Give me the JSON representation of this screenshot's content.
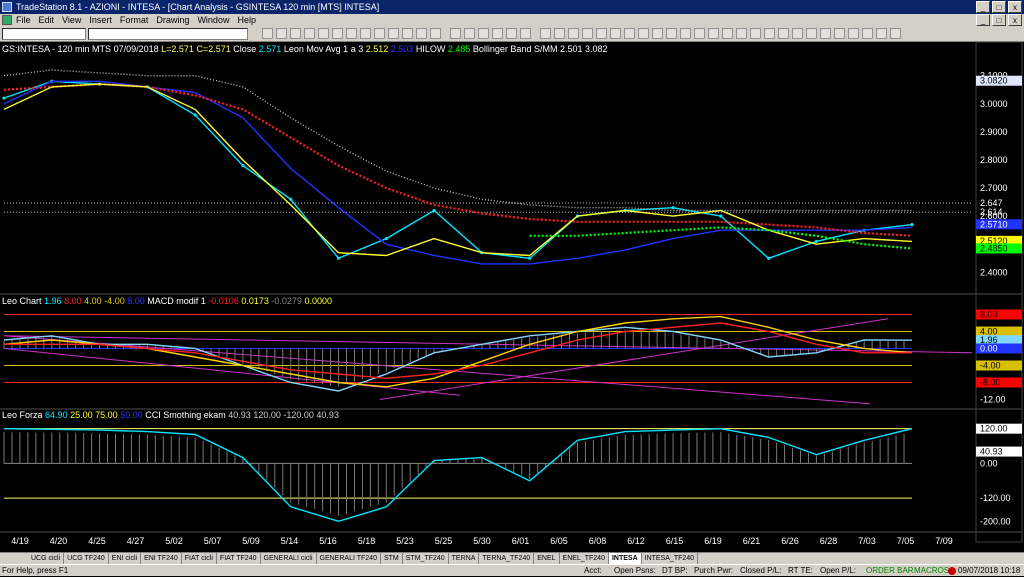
{
  "window": {
    "title": "TradeStation 8.1 - AZIONI - INTESA - [Chart Analysis - GSINTESA  120 min  [MTS] INTESA]"
  },
  "menu": [
    "File",
    "Edit",
    "View",
    "Insert",
    "Format",
    "Drawing",
    "Window",
    "Help"
  ],
  "toolbar": {
    "symbol": "",
    "dropdown": ""
  },
  "status_line": {
    "price": {
      "symbol": "GS:INTESA - 120 min",
      "mts": "MTS",
      "date": "07/09/2018",
      "low": "L=2.571",
      "close": "C=2.571",
      "close_label": "Close",
      "close_val": "2.571",
      "mov_label": "Leon Mov Avg 1 a 3",
      "mov1": "2.512",
      "mov2": "2.503",
      "hilow_label": "HILOW",
      "hilow_val": "2.485",
      "boll_label": "Bollinger Band S/MM",
      "boll1": "2.501",
      "boll2": "3.082"
    },
    "leo": {
      "label": "Leo Chart",
      "v1": "1.96",
      "v2": "8.00",
      "v3": "4.00",
      "v4": "-4.00",
      "v5": "8.00",
      "macd_label": "MACD modif 1",
      "m1": "-0.0106",
      "m2": "0.0173",
      "m3": "-0.0279",
      "m4": "0.0000"
    },
    "forza": {
      "label": "Leo Forza",
      "f1": "64.90",
      "f2": "25.00",
      "f3": "75.00",
      "f4": "50.00",
      "cci_label": "CCI Smothing ekam",
      "c1": "40.93",
      "c2": "120.00",
      "c3": "-120.00",
      "c4": "40.93"
    }
  },
  "price_axis": [
    "3.1000",
    "3.0000",
    "2.9000",
    "2.8000",
    "2.7000",
    "2.6000",
    "2.5000",
    "2.4000"
  ],
  "price_badges": [
    {
      "text": "3.0820",
      "bg": "#dfe8ff",
      "fg": "#000000"
    },
    {
      "text": "2.647",
      "bg": "#000000",
      "fg": "#ffffff"
    },
    {
      "text": "2.614",
      "bg": "#000000",
      "fg": "#ffffff"
    },
    {
      "text": "2.5710",
      "bg": "#2233ff",
      "fg": "#ffffff"
    },
    {
      "text": "2.5120",
      "bg": "#ffff00",
      "fg": "#000000"
    },
    {
      "text": "2.4850",
      "bg": "#00ff00",
      "fg": "#000000"
    }
  ],
  "leo_axis": [
    "-12.00"
  ],
  "leo_badges": [
    {
      "text": "8.00",
      "bg": "#ff0000",
      "fg": "#000000"
    },
    {
      "text": "4.00",
      "bg": "#d8c000",
      "fg": "#000000"
    },
    {
      "text": "1.96",
      "bg": "#7fd7ff",
      "fg": "#000000"
    },
    {
      "text": "0.00",
      "bg": "#2233ff",
      "fg": "#ffffff"
    },
    {
      "text": "-4.00",
      "bg": "#d8c000",
      "fg": "#000000"
    },
    {
      "text": "-8.00",
      "bg": "#ff0000",
      "fg": "#000000"
    }
  ],
  "forza_axis": [
    "0.00",
    "-120.00",
    "-200.00"
  ],
  "forza_badges": [
    {
      "text": "120.00",
      "bg": "#ffffff",
      "fg": "#000000"
    },
    {
      "text": "40.93",
      "bg": "#ffffff",
      "fg": "#000000"
    }
  ],
  "date_axis": [
    "4/19",
    "4/20",
    "4/25",
    "4/27",
    "5/02",
    "5/07",
    "5/09",
    "5/14",
    "5/16",
    "5/18",
    "5/23",
    "5/25",
    "5/30",
    "6/01",
    "6/05",
    "6/08",
    "6/12",
    "6/15",
    "6/19",
    "6/21",
    "6/26",
    "6/28",
    "7/03",
    "7/05",
    "7/09"
  ],
  "tabs": [
    "UCG cicli",
    "UCG TF240",
    "ENI cicli",
    "ENI TF240",
    "FIAT cicli",
    "FIAT TF240",
    "GENERALI cicli",
    "GENERALI TF240",
    "STM",
    "STM_TF240",
    "TERNA",
    "TERNA_TF240",
    "ENEL",
    "ENEL_TF240",
    "INTESA",
    "INTESA_TF240"
  ],
  "active_tab": "INTESA",
  "statusbar": {
    "help": "For Help, press F1",
    "acct": "Acct:",
    "open_psns": "Open Psns:",
    "dt_bp": "DT BP:",
    "purch_pwr": "Purch Pwr:",
    "closed_pl": "Closed P/L:",
    "rt_te": "RT TE:",
    "open_pl": "Open P/L:",
    "order_bar": "ORDER BAR",
    "macros": "MACROS",
    "clock": "09/07/2018 10:18"
  },
  "chart_data": [
    {
      "type": "line",
      "title": "",
      "x": [
        "4/19",
        "4/25",
        "5/02",
        "5/09",
        "5/16",
        "5/18",
        "5/23",
        "5/25",
        "5/30",
        "6/01",
        "6/05",
        "6/08",
        "6/12",
        "6/15",
        "6/19",
        "6/21",
        "6/26",
        "6/28",
        "7/03",
        "7/05"
      ],
      "ylim": [
        2.33,
        3.17
      ],
      "series": [
        {
          "values": [
            3.02,
            3.08,
            3.07,
            3.06,
            2.96,
            2.78,
            2.66,
            2.45,
            2.52,
            2.62,
            2.47,
            2.45,
            2.6,
            2.62,
            2.63,
            2.6,
            2.45,
            2.51,
            2.55,
            2.57
          ],
          "color": "#00e5ff"
        },
        {
          "values": [
            3.0,
            3.08,
            3.08,
            3.06,
            3.04,
            2.95,
            2.77,
            2.63,
            2.5,
            2.46,
            2.43,
            2.43,
            2.45,
            2.48,
            2.52,
            2.55,
            2.55,
            2.55,
            2.55,
            2.56
          ],
          "color": "#2233ff"
        },
        {
          "values": [
            3.05,
            3.06,
            3.07,
            3.06,
            3.03,
            2.98,
            2.88,
            2.78,
            2.7,
            2.64,
            2.61,
            2.59,
            2.58,
            2.58,
            2.58,
            2.58,
            2.57,
            2.56,
            2.54,
            2.53
          ],
          "color": "#ff2020"
        },
        {
          "values": [
            2.98,
            3.06,
            3.07,
            3.06,
            2.98,
            2.8,
            2.64,
            2.47,
            2.46,
            2.52,
            2.47,
            2.46,
            2.6,
            2.62,
            2.6,
            2.62,
            2.55,
            2.5,
            2.52,
            2.51
          ],
          "color": "#ffff33"
        },
        {
          "values": [
            null,
            null,
            null,
            null,
            null,
            null,
            null,
            null,
            null,
            null,
            null,
            2.53,
            2.53,
            2.54,
            2.55,
            2.56,
            2.55,
            2.53,
            2.5,
            2.485
          ],
          "color": "#00ff00"
        },
        {
          "values": [
            3.1,
            3.12,
            3.11,
            3.1,
            3.1,
            3.06,
            2.95,
            2.85,
            2.76,
            2.7,
            2.66,
            2.64,
            2.63,
            2.63,
            2.62,
            2.62,
            2.62,
            2.62,
            2.62,
            2.62
          ],
          "color": "#c0c0c0"
        }
      ]
    },
    {
      "type": "line",
      "title": "",
      "x": [
        "4/19",
        "4/25",
        "5/02",
        "5/09",
        "5/16",
        "5/18",
        "5/23",
        "5/25",
        "5/30",
        "6/01",
        "6/05",
        "6/08",
        "6/12",
        "6/15",
        "6/19",
        "6/21",
        "6/26",
        "6/28",
        "7/03",
        "7/05"
      ],
      "ylim": [
        -14,
        10
      ],
      "series": [
        {
          "values": [
            2,
            3,
            1,
            1,
            0,
            -4,
            -8,
            -10,
            -6,
            -1,
            1,
            3,
            4,
            5,
            4,
            2,
            -2,
            -1,
            2,
            1.96
          ],
          "color": "#7fd7ff"
        },
        {
          "values": [
            1,
            2,
            1,
            0,
            -2,
            -4,
            -6,
            -8,
            -9,
            -7,
            -3,
            1,
            4,
            6,
            7,
            7.5,
            5,
            2,
            0,
            -1
          ],
          "color": "#ffd000"
        },
        {
          "values": [
            1,
            1,
            1,
            0,
            -1,
            -3,
            -5,
            -6,
            -7,
            -6,
            -4,
            -1,
            2,
            4,
            5,
            6,
            4,
            1,
            -1,
            -1
          ],
          "color": "#ff2020"
        }
      ]
    },
    {
      "type": "line",
      "title": "",
      "x": [
        "4/19",
        "4/25",
        "5/02",
        "5/09",
        "5/16",
        "5/18",
        "5/23",
        "5/25",
        "5/30",
        "6/01",
        "6/05",
        "6/08",
        "6/12",
        "6/15",
        "6/19",
        "6/21",
        "6/26",
        "6/28",
        "7/03",
        "7/05"
      ],
      "ylim": [
        -230,
        150
      ],
      "series": [
        {
          "values": [
            120,
            118,
            115,
            110,
            100,
            20,
            -150,
            -200,
            -150,
            10,
            20,
            -60,
            80,
            110,
            115,
            120,
            90,
            30,
            80,
            120
          ],
          "color": "#00e5ff"
        }
      ]
    }
  ]
}
